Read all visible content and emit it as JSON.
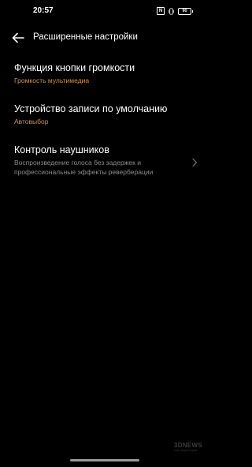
{
  "status_bar": {
    "time": "20:57",
    "nfc_label": "N",
    "battery_level": "90",
    "icons": [
      "nfc-icon",
      "vibrate-icon",
      "battery-icon"
    ]
  },
  "header": {
    "back_icon": "arrow-left-icon",
    "title": "Расширенные настройки"
  },
  "settings": [
    {
      "title": "Функция кнопки громкости",
      "subtitle": "Громкость мультимедиа"
    },
    {
      "title": "Устройство записи по умолчанию",
      "subtitle": "Автовыбор"
    },
    {
      "title": "Контроль наушников",
      "subtitle": "Воспроизведение голоса без задержек и профессиональные эффекты реверберации",
      "icon": "chevron-right-icon"
    }
  ],
  "watermark": {
    "brand": "3DNEWS",
    "tagline": "Daily Digital Digest"
  },
  "colors": {
    "background": "#000000",
    "text": "#ffffff",
    "accent": "#d4914a",
    "muted": "#8c8c8c"
  }
}
